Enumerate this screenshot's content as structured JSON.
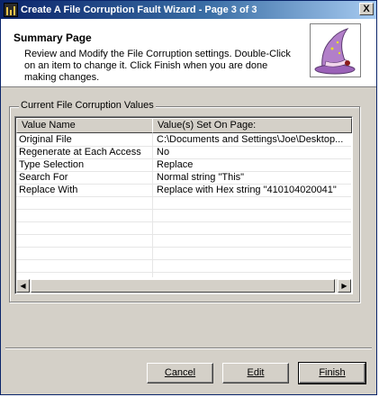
{
  "window": {
    "title": "Create A File Corruption Fault Wizard - Page 3 of 3",
    "close_label": "X"
  },
  "header": {
    "title": "Summary Page",
    "description": "Review and Modify the File Corruption settings. Double-Click on an item to change it.  Click Finish when you are done making changes.",
    "image_icon": "wizard-hat-icon"
  },
  "group": {
    "legend": "Current File Corruption Values",
    "columns": [
      "Value Name",
      "Value(s) Set On Page:"
    ],
    "rows": [
      {
        "name": "Original File",
        "value": "C:\\Documents and Settings\\Joe\\Desktop..."
      },
      {
        "name": "Regenerate at Each Access",
        "value": "No"
      },
      {
        "name": "Type Selection",
        "value": "Replace"
      },
      {
        "name": "Search For",
        "value": "Normal string \"This\""
      },
      {
        "name": "Replace With",
        "value": "Replace with Hex string \"410104020041\""
      }
    ],
    "scroll_left_glyph": "◀",
    "scroll_right_glyph": "▶"
  },
  "buttons": {
    "cancel": "Cancel",
    "edit": "Edit",
    "finish": "Finish"
  },
  "colors": {
    "titlebar_start": "#0a246a",
    "titlebar_end": "#a6caf0",
    "face": "#d4d0c8",
    "hat": "#b27fc9"
  }
}
